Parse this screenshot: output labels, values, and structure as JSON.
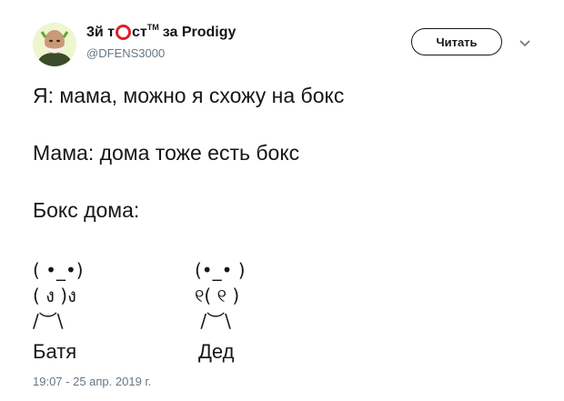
{
  "author": {
    "name_part1": "3й т",
    "name_part2": "ст",
    "tm": "TM",
    "name_part3": "за Prodigy",
    "handle": "@DFENS3000"
  },
  "follow_label": "Читать",
  "icons": {
    "avatar": "bald-bearded-man-avatar",
    "menu": "chevron-down-icon",
    "logo_o": "red-ring-o"
  },
  "colors": {
    "logo_red": "#e0202a",
    "muted": "#657786",
    "text": "#14171a"
  },
  "tweet": {
    "line1": "Я: мама, можно я схожу на бокс",
    "line2": "Мама: дома тоже есть бокс",
    "line3": "Бокс дома:"
  },
  "art": {
    "left": "( •_•)\n( ง )ง\n/︶\\",
    "left_label": "Батя",
    "right": "(•_• )\n୧( ୧ )\n /︶\\",
    "right_label": "Дед"
  },
  "timestamp": "19:07 - 25 апр. 2019 г."
}
